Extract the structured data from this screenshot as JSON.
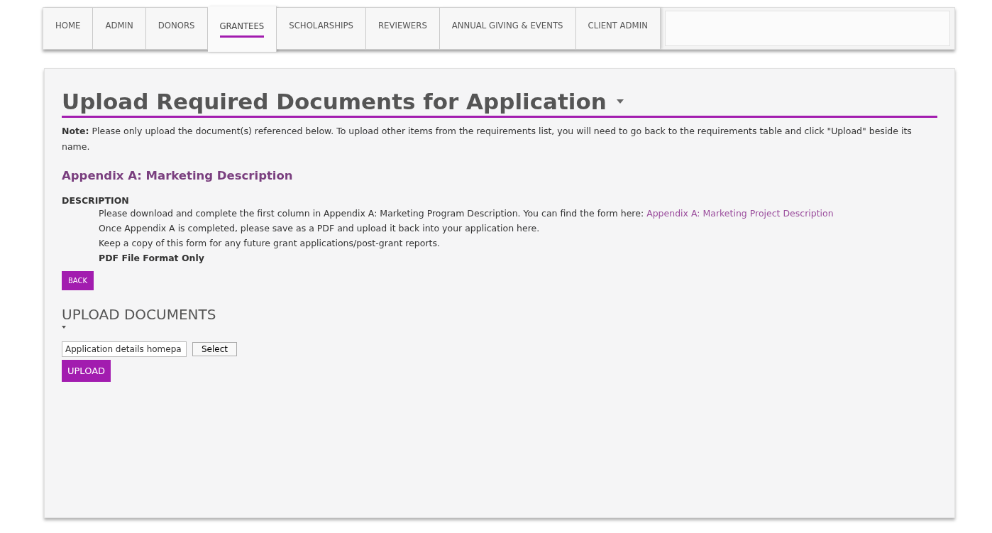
{
  "nav": {
    "tabs": [
      {
        "label": "HOME",
        "selected": false
      },
      {
        "label": "ADMIN",
        "selected": false
      },
      {
        "label": "DONORS",
        "selected": false
      },
      {
        "label": "GRANTEES",
        "selected": true
      },
      {
        "label": "SCHOLARSHIPS",
        "selected": false
      },
      {
        "label": "REVIEWERS",
        "selected": false
      },
      {
        "label": "ANNUAL GIVING & EVENTS",
        "selected": false
      },
      {
        "label": "CLIENT ADMIN",
        "selected": false
      }
    ]
  },
  "page": {
    "title": "Upload Required Documents for Application",
    "note": "**Note:** Please only upload the document(s) referenced below. To upload other items from the requirements list, you will need to go back to the requirements table and click \"Upload\" beside its name.",
    "requirement": "Appendix A: Marketing Description",
    "description_heading": "DESCRIPTION",
    "description": [
      {
        "kind": "text",
        "text": "Please download and complete the first column in Appendix A: Marketing Program Description. You can find the form here:",
        "link": "Appendix A: Marketing Project Description"
      },
      {
        "kind": "text",
        "text": "Once Appendix A is completed, please save as a PDF and upload it back into your application here."
      },
      {
        "kind": "text",
        "text": "Keep a copy of this form for any future grant applications/post-grant reports."
      },
      {
        "kind": "bold",
        "text": "PDF File Format Only"
      }
    ],
    "back_button": "BACK",
    "upload_heading": "UPLOAD DOCUMENTS",
    "file_field": {
      "value": "Application details homepa"
    },
    "select_button": "Select",
    "upload_button": "UPLOAD"
  }
}
